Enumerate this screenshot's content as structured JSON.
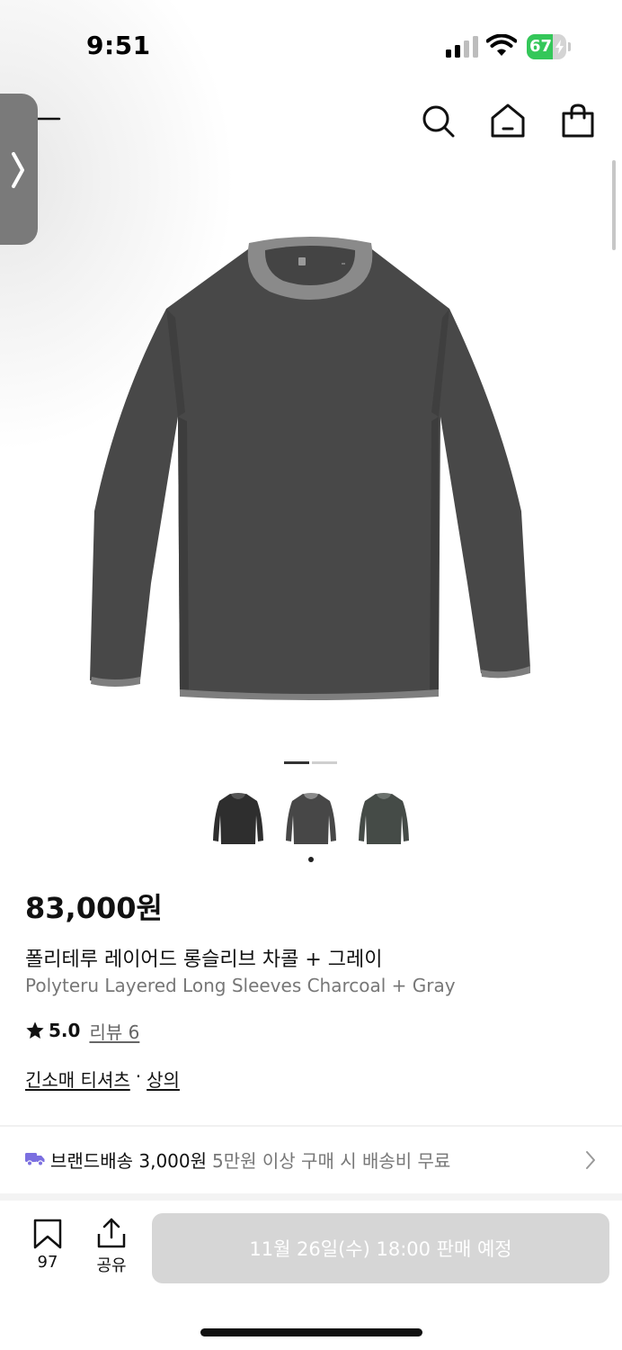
{
  "status_bar": {
    "time": "9:51",
    "battery_level": "67",
    "battery_fraction": 0.67,
    "battery_color": "#34c759"
  },
  "header": {
    "icons": [
      "menu-icon",
      "search-icon",
      "home-icon",
      "shopping-bag-icon"
    ],
    "side_tab_icon": "chevron-right-icon"
  },
  "gallery": {
    "active_indicator": 1,
    "indicator_count": 2,
    "thumbnails": [
      "thumbnail-black",
      "thumbnail-charcoal-gray",
      "thumbnail-green-gray"
    ],
    "selected_thumbnail": 1
  },
  "product": {
    "price": "83,000원",
    "name_ko": "폴리테루 레이어드 롱슬리브 차콜 + 그레이",
    "name_en": "Polyteru Layered Long Sleeves Charcoal + Gray",
    "rating": "5.0",
    "review_label": "리뷰 6",
    "category_1": "긴소매 티셔츠",
    "category_sep": "·",
    "category_2": "상의"
  },
  "shipping": {
    "label": "브랜드배송 3,000원",
    "description": "5만원 이상 구매 시 배송비 무료",
    "icon_color": "#7b6fe0"
  },
  "bottom_bar": {
    "bookmark_count": "97",
    "share_label": "공유",
    "buy_button_label": "11월 26일(수) 18:00 판매 예정"
  }
}
